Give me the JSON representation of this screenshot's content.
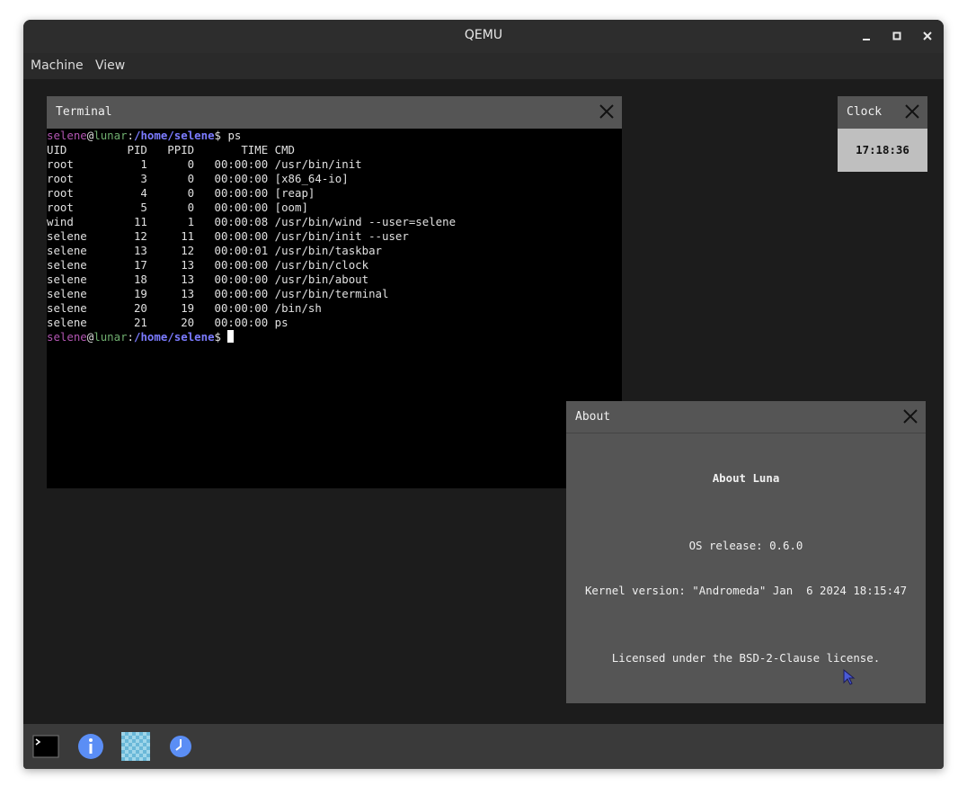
{
  "window": {
    "title": "QEMU"
  },
  "controls": {
    "minimize": "–",
    "maximize": "□",
    "close": "✕"
  },
  "menu": {
    "machine": "Machine",
    "view": "View"
  },
  "terminal": {
    "title": "Terminal",
    "prompt": {
      "user": "selene",
      "at": "@",
      "host": "lunar",
      "sep": ":",
      "path": "/home/selene",
      "sigil": "$ "
    },
    "command": "ps",
    "header": "UID         PID   PPID       TIME CMD",
    "rows": [
      "root          1      0   00:00:00 /usr/bin/init",
      "root          3      0   00:00:00 [x86_64-io]",
      "root          4      0   00:00:00 [reap]",
      "root          5      0   00:00:00 [oom]",
      "wind         11      1   00:00:08 /usr/bin/wind --user=selene",
      "selene       12     11   00:00:00 /usr/bin/init --user",
      "selene       13     12   00:00:01 /usr/bin/taskbar",
      "selene       17     13   00:00:00 /usr/bin/clock",
      "selene       18     13   00:00:00 /usr/bin/about",
      "selene       19     13   00:00:00 /usr/bin/terminal",
      "selene       20     19   00:00:00 /bin/sh",
      "selene       21     20   00:00:00 ps"
    ]
  },
  "clock": {
    "title": "Clock",
    "time": "17:18:36"
  },
  "about": {
    "title": "About",
    "heading": "About Luna",
    "release": "OS release: 0.6.0",
    "kernel": "Kernel version: \"Andromeda\" Jan  6 2024 18:15:47",
    "license": "Licensed under the BSD-2-Clause license."
  },
  "taskbar": {
    "icons": [
      "terminal-icon",
      "info-icon",
      "checkerboard-icon",
      "clock-icon"
    ]
  },
  "colors": {
    "prompt_user": "#b155b1",
    "prompt_host": "#6fae6f",
    "prompt_path": "#7b7bff",
    "accent_blue": "#5b8ef5"
  }
}
